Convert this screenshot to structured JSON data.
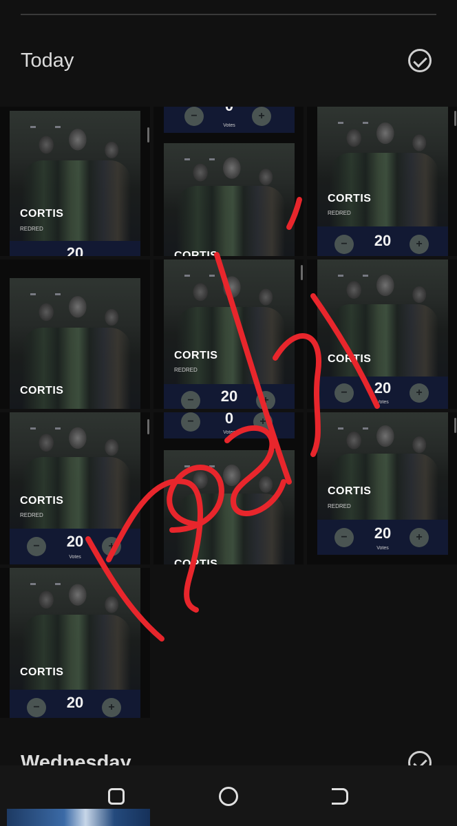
{
  "sections": {
    "today": "Today",
    "wednesday": "Wednesday"
  },
  "card": {
    "name": "CORTIS",
    "sub": "REDRED",
    "votes": "20",
    "votes_partial": "0",
    "votes_label": "Votes",
    "minus": "−",
    "plus": "+"
  },
  "icons": {
    "select": "check-circle-icon",
    "nav_recent": "recent-apps-icon",
    "nav_home": "home-icon",
    "nav_back": "back-icon"
  },
  "overlay": {
    "color": "#e8262c"
  }
}
